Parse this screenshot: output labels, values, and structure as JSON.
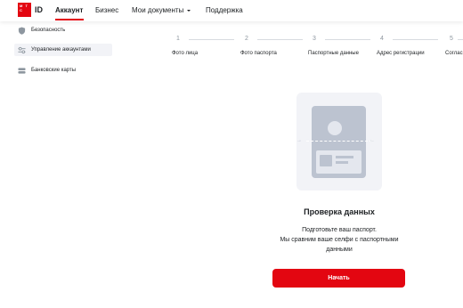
{
  "header": {
    "logo_letters": "М Т С",
    "logo_id": "ID",
    "nav": [
      {
        "label": "Аккаунт",
        "active": true
      },
      {
        "label": "Бизнес",
        "active": false
      },
      {
        "label": "Мои документы",
        "active": false
      },
      {
        "label": "Поддержка",
        "active": false
      }
    ],
    "accent_color": "#e30611"
  },
  "sidebar": {
    "items": [
      {
        "label": "Безопасность",
        "icon": "shield-icon"
      },
      {
        "label": "Управление аккаунтами",
        "icon": "sliders-icon"
      },
      {
        "label": "Банковские карты",
        "icon": "cards-icon"
      }
    ]
  },
  "stepper": {
    "steps": [
      {
        "num": "1",
        "label": "Фото лица"
      },
      {
        "num": "2",
        "label": "Фото паспорта"
      },
      {
        "num": "3",
        "label": "Паспортные данные"
      },
      {
        "num": "4",
        "label": "Адрес регистрации"
      },
      {
        "num": "5",
        "label": "Соглас"
      }
    ]
  },
  "main": {
    "title": "Проверка данных",
    "description_line1": "Подготовьте ваш паспорт.",
    "description_line2": "Мы сравним ваше селфи с паспортными",
    "description_line3": "данными",
    "start_button": "Начать"
  }
}
